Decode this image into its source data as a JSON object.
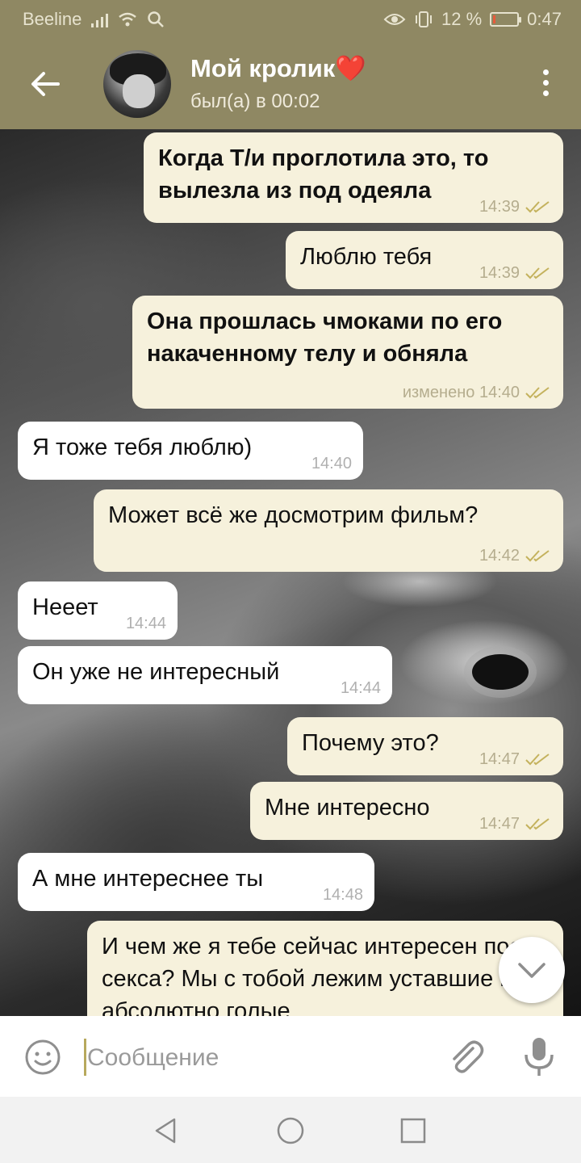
{
  "status_bar": {
    "carrier": "Beeline",
    "battery": "12 %",
    "battery_level": 0.12,
    "time": "0:47",
    "icons": [
      "signal-icon",
      "wifi-icon",
      "search-icon",
      "eye-icon",
      "vibrate-icon",
      "battery-icon"
    ]
  },
  "header": {
    "title": "Мой кролик",
    "title_emoji": "❤️",
    "subtitle": "был(а) в 00:02",
    "icons": [
      "back-arrow-icon",
      "avatar",
      "more-vert-icon"
    ]
  },
  "messages": [
    {
      "dir": "out",
      "text": "Когда Т/и проглотила это, то вылезла из под одеяла",
      "time": "14:39",
      "read": true,
      "bold": true
    },
    {
      "dir": "out",
      "text": "Люблю тебя",
      "time": "14:39",
      "read": true,
      "bold": false
    },
    {
      "dir": "out",
      "text": "Она прошлась чмоками по его накаченному телу и обняла",
      "time": "изменено 14:40",
      "read": true,
      "bold": true
    },
    {
      "dir": "in",
      "text": "Я тоже тебя люблю)",
      "time": "14:40"
    },
    {
      "dir": "out",
      "text": "Может всё же досмотрим фильм?",
      "time": "14:42",
      "read": true,
      "bold": false
    },
    {
      "dir": "in",
      "text": "Нееет",
      "time": "14:44"
    },
    {
      "dir": "in",
      "text": "Он уже не интересный",
      "time": "14:44"
    },
    {
      "dir": "out",
      "text": "Почему это?",
      "time": "14:47",
      "read": true,
      "bold": false
    },
    {
      "dir": "out",
      "text": "Мне интересно",
      "time": "14:47",
      "read": true,
      "bold": false
    },
    {
      "dir": "in",
      "text": "А мне интереснее ты",
      "time": "14:48"
    },
    {
      "dir": "out",
      "text": "И чем же я тебе сейчас интересен после секса? Мы с тобой лежим уставшие и абсолютно голые",
      "time": "",
      "read": false,
      "bold": false
    }
  ],
  "composer": {
    "placeholder": "Сообщение",
    "value": "",
    "icons": [
      "emoji-icon",
      "attach-icon",
      "mic-icon"
    ]
  },
  "scroll_down": {
    "icon": "chevron-down-icon"
  },
  "nav_bar": {
    "icons": [
      "nav-back-icon",
      "nav-home-icon",
      "nav-recents-icon"
    ]
  },
  "colors": {
    "header_bg": "#8f8863",
    "outgoing_bubble": "#f6f1dc",
    "incoming_bubble": "#ffffff",
    "meta_text": "#b5ad8e",
    "tick_color": "#c4b25d",
    "battery_low": "#e85a3b"
  }
}
